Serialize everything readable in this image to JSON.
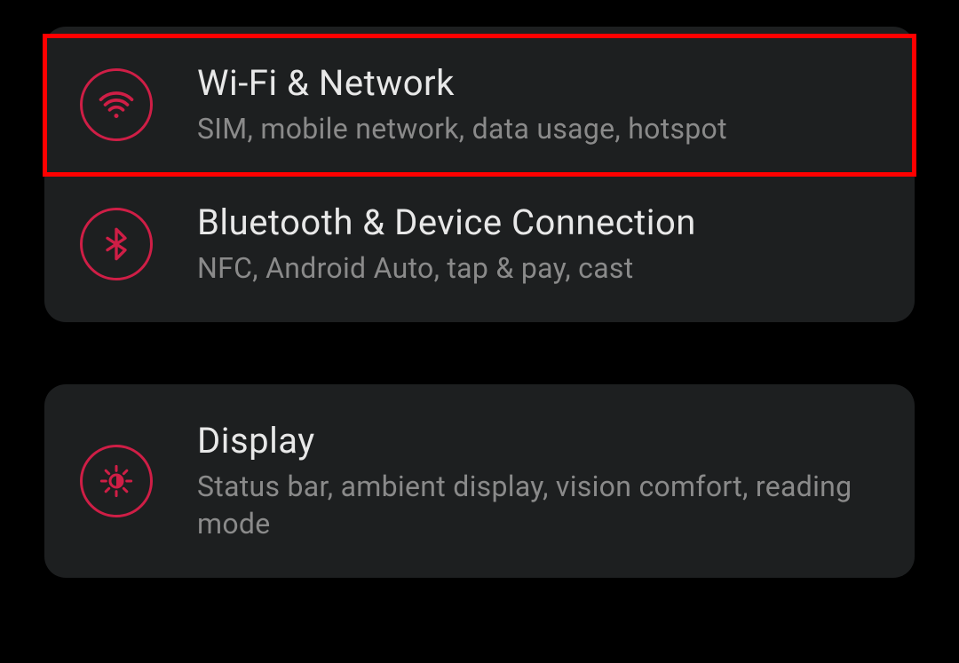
{
  "accent_color": "#cf1e46",
  "groups": [
    {
      "items": [
        {
          "id": "wifi-network",
          "icon": "wifi",
          "title": "Wi-Fi & Network",
          "subtitle": "SIM, mobile network, data usage, hotspot",
          "highlighted": true
        },
        {
          "id": "bluetooth-device",
          "icon": "bluetooth",
          "title": "Bluetooth & Device Connection",
          "subtitle": "NFC, Android Auto, tap & pay, cast",
          "highlighted": false
        }
      ]
    },
    {
      "items": [
        {
          "id": "display",
          "icon": "brightness",
          "title": "Display",
          "subtitle": "Status bar, ambient display, vision comfort, reading mode",
          "highlighted": false
        }
      ]
    }
  ]
}
